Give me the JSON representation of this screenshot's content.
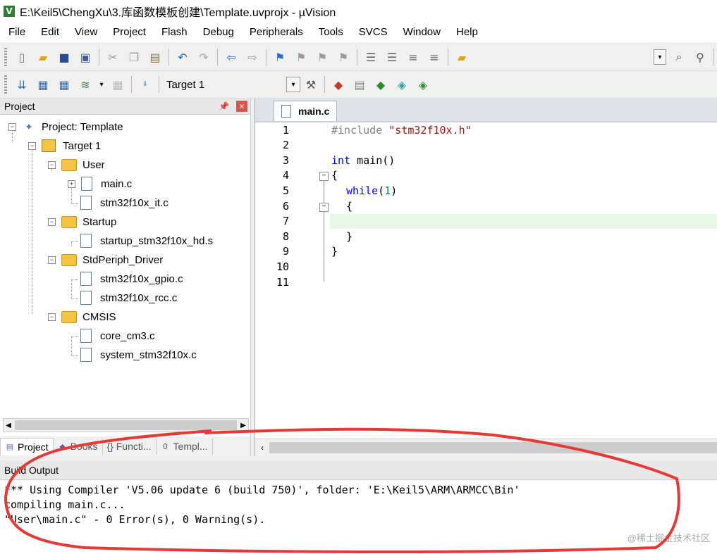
{
  "window": {
    "title": "E:\\Keil5\\ChengXu\\3.库函数模板创建\\Template.uvprojx - µVision",
    "app_icon": "V"
  },
  "menu": [
    "File",
    "Edit",
    "View",
    "Project",
    "Flash",
    "Debug",
    "Peripherals",
    "Tools",
    "SVCS",
    "Window",
    "Help"
  ],
  "toolbar2": {
    "target": "Target 1"
  },
  "project_panel": {
    "title": "Project",
    "tree": [
      {
        "label": "Project: Template",
        "type": "project"
      },
      {
        "label": "Target 1",
        "type": "target"
      },
      {
        "label": "User",
        "type": "folder"
      },
      {
        "label": "main.c",
        "type": "file"
      },
      {
        "label": "stm32f10x_it.c",
        "type": "file"
      },
      {
        "label": "Startup",
        "type": "folder"
      },
      {
        "label": "startup_stm32f10x_hd.s",
        "type": "file"
      },
      {
        "label": "StdPeriph_Driver",
        "type": "folder"
      },
      {
        "label": "stm32f10x_gpio.c",
        "type": "file"
      },
      {
        "label": "stm32f10x_rcc.c",
        "type": "file"
      },
      {
        "label": "CMSIS",
        "type": "folder"
      },
      {
        "label": "core_cm3.c",
        "type": "file"
      },
      {
        "label": "system_stm32f10x.c",
        "type": "file"
      }
    ],
    "tabs": [
      "Project",
      "Books",
      "{} Functi...",
      "Templ..."
    ]
  },
  "editor": {
    "tab": "main.c",
    "line_numbers": [
      "1",
      "2",
      "3",
      "4",
      "5",
      "6",
      "7",
      "8",
      "9",
      "10",
      "11"
    ],
    "lines": {
      "l1_pre": "#include",
      "l1_str": "\"stm32f10x.h\"",
      "l3_kw": "int",
      "l3_rest": " main()",
      "l4": "{",
      "l5_kw": "while",
      "l5_open": "(",
      "l5_num": "1",
      "l5_close": ")",
      "l6": "{",
      "l8": "}",
      "l9": "}"
    }
  },
  "build_output": {
    "title": "Build Output",
    "lines": [
      "*** Using Compiler 'V5.06 update 6 (build 750)', folder: 'E:\\Keil5\\ARM\\ARMCC\\Bin'",
      "compiling main.c...",
      "\"User\\main.c\" - 0 Error(s), 0 Warning(s)."
    ],
    "watermark": "@稀土掘金技术社区"
  }
}
